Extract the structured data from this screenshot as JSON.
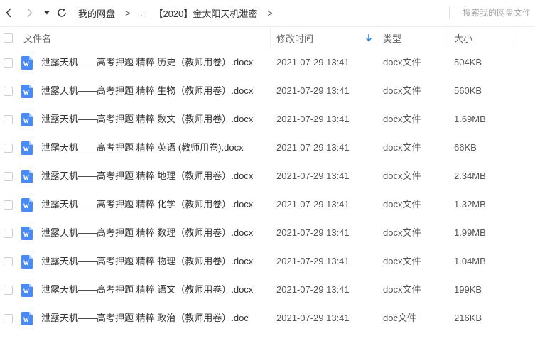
{
  "nav": {
    "back_icon": "chevron-left-icon",
    "forward_icon": "chevron-right-icon",
    "history_icon": "caret-down-icon",
    "refresh_icon": "refresh-icon"
  },
  "breadcrumb": {
    "root": "我的网盘",
    "separator": ">",
    "ellipsis": "...",
    "current": "【2020】金太阳天机泄密"
  },
  "search": {
    "placeholder": "搜索我的网盘文件"
  },
  "colors": {
    "accent": "#2e7cf6",
    "doc_icon": "#4a8af4",
    "sort_arrow": "#2e86de"
  },
  "columns": {
    "name": "文件名",
    "modified": "修改时间",
    "type": "类型",
    "size": "大小",
    "sort_icon": "sort-desc-arrow-icon"
  },
  "files": [
    {
      "name": "泄露天机——高考押题 精粹 历史（教师用卷）.docx",
      "modified": "2021-07-29 13:41",
      "type": "docx文件",
      "size": "504KB"
    },
    {
      "name": "泄露天机——高考押题 精粹 生物（教师用卷）.docx",
      "modified": "2021-07-29 13:41",
      "type": "docx文件",
      "size": "560KB"
    },
    {
      "name": "泄露天机——高考押题 精粹 数文（教师用卷）.docx",
      "modified": "2021-07-29 13:41",
      "type": "docx文件",
      "size": "1.69MB"
    },
    {
      "name": "泄露天机——高考押题 精粹 英语 (教师用卷).docx",
      "modified": "2021-07-29 13:41",
      "type": "docx文件",
      "size": "66KB"
    },
    {
      "name": "泄露天机——高考押题 精粹 地理（教师用卷）.docx",
      "modified": "2021-07-29 13:41",
      "type": "docx文件",
      "size": "2.34MB"
    },
    {
      "name": "泄露天机——高考押题 精粹 化学（教师用卷）.docx",
      "modified": "2021-07-29 13:41",
      "type": "docx文件",
      "size": "1.32MB"
    },
    {
      "name": "泄露天机——高考押题 精粹 数理（教师用卷）.docx",
      "modified": "2021-07-29 13:41",
      "type": "docx文件",
      "size": "1.99MB"
    },
    {
      "name": "泄露天机——高考押题 精粹 物理（教师用卷）.docx",
      "modified": "2021-07-29 13:41",
      "type": "docx文件",
      "size": "1.04MB"
    },
    {
      "name": "泄露天机——高考押题 精粹 语文（教师用卷）.docx",
      "modified": "2021-07-29 13:41",
      "type": "docx文件",
      "size": "199KB"
    },
    {
      "name": "泄露天机——高考押题 精粹 政治（教师用卷）.doc",
      "modified": "2021-07-29 13:41",
      "type": "doc文件",
      "size": "216KB"
    }
  ]
}
